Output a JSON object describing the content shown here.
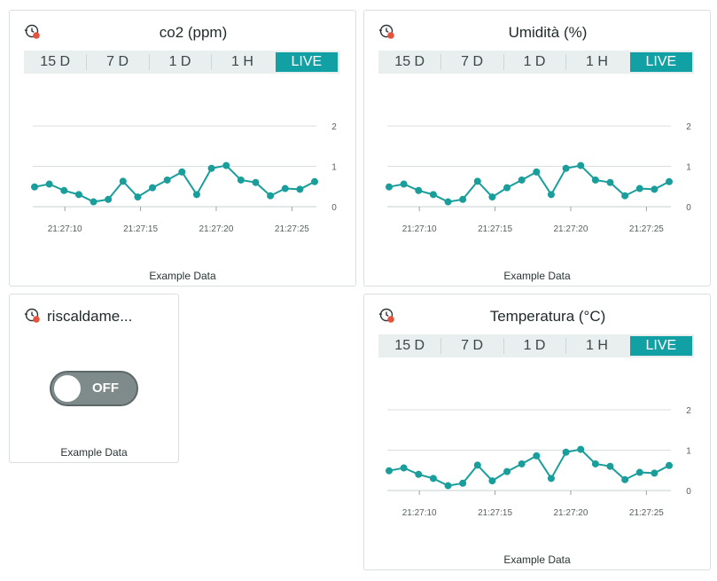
{
  "widgets": [
    {
      "title": "co2 (ppm)",
      "tabs": [
        "15 D",
        "7 D",
        "1 D",
        "1 H",
        "LIVE"
      ],
      "active_tab": "LIVE",
      "caption": "Example Data"
    },
    {
      "title": "Umidità (%)",
      "tabs": [
        "15 D",
        "7 D",
        "1 D",
        "1 H",
        "LIVE"
      ],
      "active_tab": "LIVE",
      "caption": "Example Data"
    },
    {
      "title": "riscaldame...",
      "switch_label": "OFF",
      "switch_state": false,
      "caption": "Example Data"
    },
    {
      "title": "Temperatura (°C)",
      "tabs": [
        "15 D",
        "7 D",
        "1 D",
        "1 H",
        "LIVE"
      ],
      "active_tab": "LIVE",
      "caption": "Example Data"
    }
  ],
  "colors": {
    "accent": "#11a0a4",
    "line": "#1a9e9b",
    "history_icon_dot": "#e5533d",
    "switch_off": "#7f8b8b"
  },
  "icons": {
    "history": "history-clock-icon"
  },
  "chart_data": [
    {
      "type": "line",
      "x": [
        "21:27:08",
        "21:27:09",
        "21:27:10",
        "21:27:11",
        "21:27:12",
        "21:27:13",
        "21:27:14",
        "21:27:15",
        "21:27:16",
        "21:27:17",
        "21:27:18",
        "21:27:19",
        "21:27:20",
        "21:27:21",
        "21:27:22",
        "21:27:23",
        "21:27:24",
        "21:27:25",
        "21:27:26"
      ],
      "x_ticks": [
        "21:27:10",
        "21:27:15",
        "21:27:20",
        "21:27:25"
      ],
      "y_ticks": [
        "0",
        "1",
        "2"
      ],
      "series": [
        {
          "values": [
            0.49,
            0.56,
            0.4,
            0.3,
            0.12,
            0.18,
            0.63,
            0.24,
            0.47,
            0.66,
            0.86,
            0.3,
            0.95,
            1.02,
            0.66,
            0.6,
            0.27,
            0.45,
            0.43,
            0.62
          ]
        }
      ],
      "ylim": [
        0,
        2
      ]
    },
    {
      "type": "line",
      "x": [
        "21:27:08",
        "21:27:09",
        "21:27:10",
        "21:27:11",
        "21:27:12",
        "21:27:13",
        "21:27:14",
        "21:27:15",
        "21:27:16",
        "21:27:17",
        "21:27:18",
        "21:27:19",
        "21:27:20",
        "21:27:21",
        "21:27:22",
        "21:27:23",
        "21:27:24",
        "21:27:25",
        "21:27:26"
      ],
      "x_ticks": [
        "21:27:10",
        "21:27:15",
        "21:27:20",
        "21:27:25"
      ],
      "y_ticks": [
        "0",
        "1",
        "2"
      ],
      "series": [
        {
          "values": [
            0.49,
            0.56,
            0.4,
            0.3,
            0.12,
            0.18,
            0.63,
            0.24,
            0.47,
            0.66,
            0.86,
            0.3,
            0.95,
            1.02,
            0.66,
            0.6,
            0.27,
            0.45,
            0.43,
            0.62
          ]
        }
      ],
      "ylim": [
        0,
        2
      ]
    },
    {
      "type": "line",
      "x": [
        "21:27:08",
        "21:27:09",
        "21:27:10",
        "21:27:11",
        "21:27:12",
        "21:27:13",
        "21:27:14",
        "21:27:15",
        "21:27:16",
        "21:27:17",
        "21:27:18",
        "21:27:19",
        "21:27:20",
        "21:27:21",
        "21:27:22",
        "21:27:23",
        "21:27:24",
        "21:27:25",
        "21:27:26"
      ],
      "x_ticks": [
        "21:27:10",
        "21:27:15",
        "21:27:20",
        "21:27:25"
      ],
      "y_ticks": [
        "0",
        "1",
        "2"
      ],
      "series": [
        {
          "values": [
            0.49,
            0.56,
            0.4,
            0.3,
            0.12,
            0.18,
            0.63,
            0.24,
            0.47,
            0.66,
            0.86,
            0.3,
            0.95,
            1.02,
            0.66,
            0.6,
            0.27,
            0.45,
            0.43,
            0.62
          ]
        }
      ],
      "ylim": [
        0,
        2
      ]
    }
  ]
}
